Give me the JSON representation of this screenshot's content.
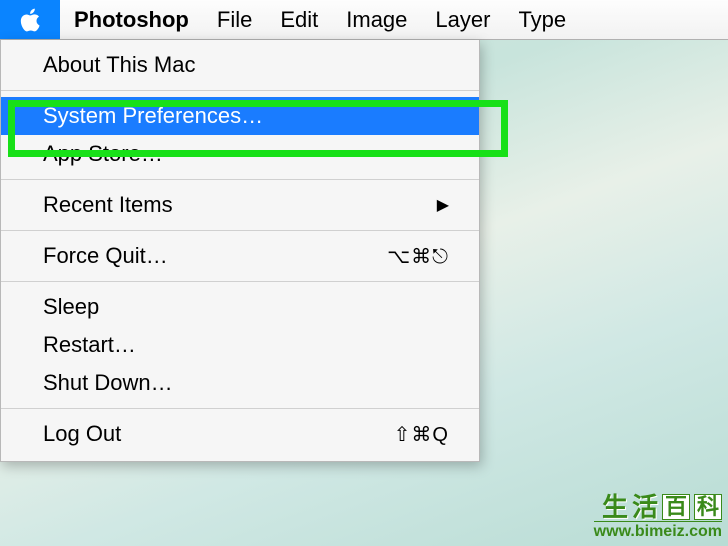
{
  "menubar": {
    "items": [
      {
        "label": "Photoshop",
        "bold": true
      },
      {
        "label": "File",
        "bold": false
      },
      {
        "label": "Edit",
        "bold": false
      },
      {
        "label": "Image",
        "bold": false
      },
      {
        "label": "Layer",
        "bold": false
      },
      {
        "label": "Type",
        "bold": false
      }
    ]
  },
  "apple_menu": {
    "about": "About This Mac",
    "system_preferences": "System Preferences…",
    "app_store": "App Store…",
    "recent_items": "Recent Items",
    "force_quit": "Force Quit…",
    "force_quit_shortcut": "⌥⌘⎋",
    "sleep": "Sleep",
    "restart": "Restart…",
    "shut_down": "Shut Down…",
    "log_out": "Log Out",
    "log_out_shortcut": "⇧⌘Q"
  },
  "watermark": {
    "chars": [
      "生",
      "活",
      "百",
      "科"
    ],
    "url": "www.bimeiz.com"
  }
}
